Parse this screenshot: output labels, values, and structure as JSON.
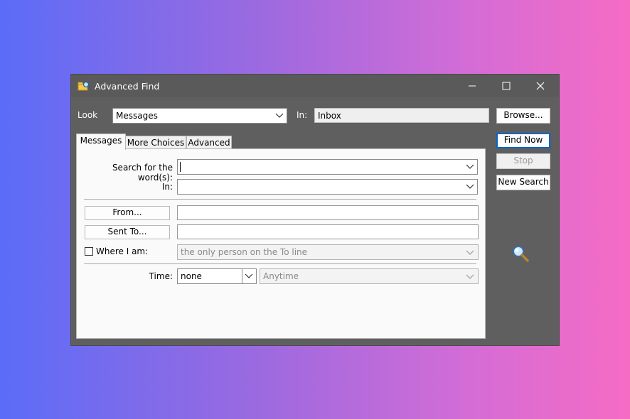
{
  "window": {
    "title": "Advanced Find",
    "icon": "find-folder-icon"
  },
  "top": {
    "look_label": "Look",
    "look_value": "Messages",
    "in_label": "In:",
    "in_value": "Inbox"
  },
  "buttons": {
    "browse": "Browse...",
    "find_now": "Find Now",
    "stop": "Stop",
    "new_search": "New Search"
  },
  "tabs": [
    {
      "label": "Messages",
      "active": true
    },
    {
      "label": "More Choices",
      "active": false
    },
    {
      "label": "Advanced",
      "active": false
    }
  ],
  "form": {
    "search_words_label": "Search for the word(s):",
    "search_words_value": "",
    "in_label": "In:",
    "in_value": "",
    "from_button": "From...",
    "from_value": "",
    "sent_to_button": "Sent To...",
    "sent_to_value": "",
    "where_label": "Where I am:",
    "where_checked": false,
    "where_value": "the only person on the To line",
    "time_label": "Time:",
    "time_value": "none",
    "time_range_value": "Anytime"
  },
  "colors": {
    "default_button_border": "#0a64c8",
    "window_bg": "#5f5f5f"
  }
}
